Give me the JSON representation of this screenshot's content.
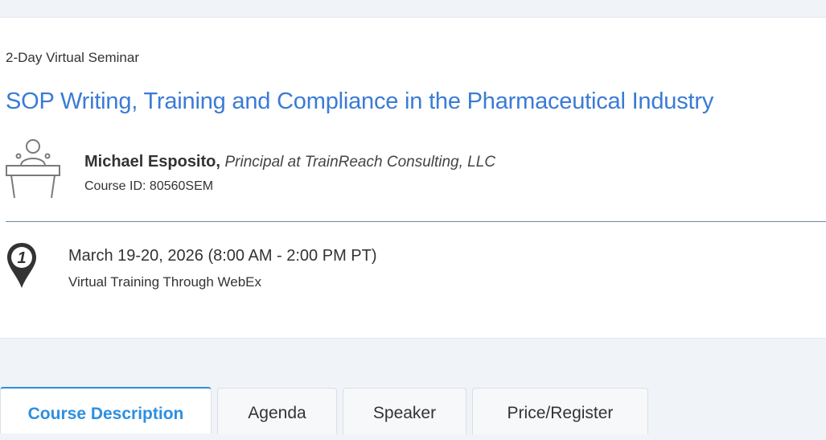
{
  "event": {
    "format": "2-Day Virtual Seminar",
    "title": "SOP Writing, Training and Compliance in the Pharmaceutical Industry"
  },
  "speaker": {
    "name": "Michael Esposito,",
    "role": "Principal at TrainReach Consulting, LLC",
    "course_id": "Course ID: 80560SEM",
    "icon": "presenter-icon"
  },
  "schedule": {
    "icon": "location-pin-icon",
    "pin_number": "1",
    "date": "March 19-20, 2026 (8:00 AM - 2:00 PM PT)",
    "venue": "Virtual Training Through WebEx"
  },
  "tabs": [
    {
      "label": "Course Description",
      "active": true
    },
    {
      "label": "Agenda",
      "active": false
    },
    {
      "label": "Speaker",
      "active": false
    },
    {
      "label": "Price/Register",
      "active": false
    }
  ],
  "colors": {
    "title": "#3a7bd5",
    "active_tab": "#2d8fe0",
    "background": "#f0f3f8"
  }
}
